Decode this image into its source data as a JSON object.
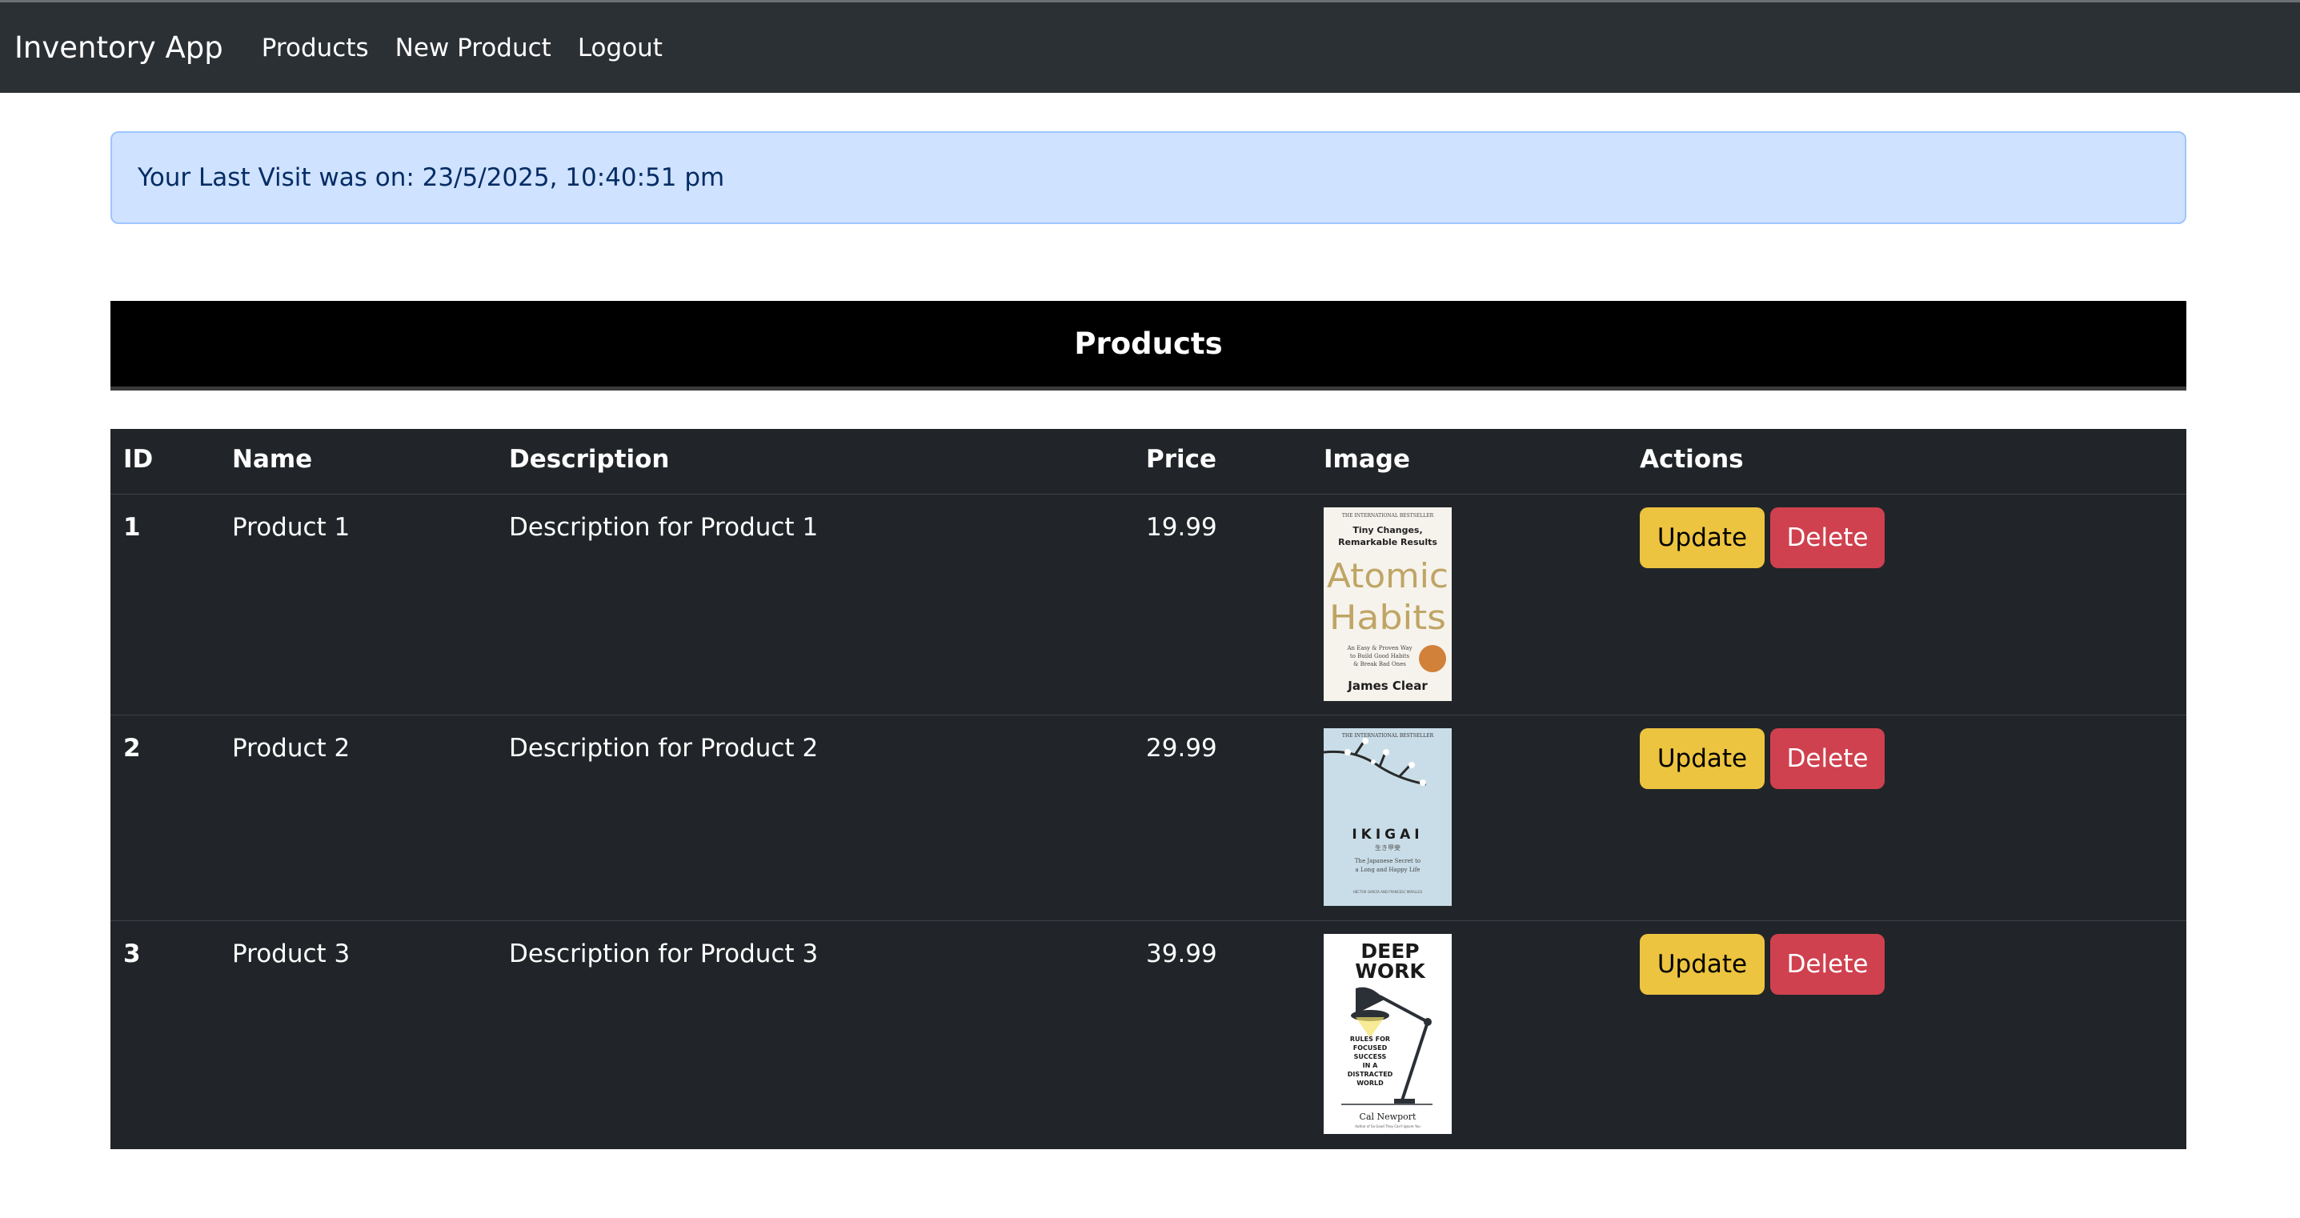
{
  "nav": {
    "brand": "Inventory App",
    "links": [
      "Products",
      "New Product",
      "Logout"
    ]
  },
  "alert": {
    "text": "Your Last Visit was on: 23/5/2025, 10:40:51 pm"
  },
  "products_header": "Products",
  "table": {
    "columns": [
      "ID",
      "Name",
      "Description",
      "Price",
      "Image",
      "Actions"
    ],
    "rows": [
      {
        "id": "1",
        "name": "Product 1",
        "description": "Description for Product 1",
        "price": "19.99",
        "cover": {
          "top": "THE INTERNATIONAL BESTSELLER",
          "tagline1": "Tiny Changes,",
          "tagline2": "Remarkable Results",
          "title1": "Atomic",
          "title2": "Habits",
          "sub1": "An Easy & Proven Way",
          "sub2": "to Build Good Habits",
          "sub3": "& Break Bad Ones",
          "author": "James Clear"
        }
      },
      {
        "id": "2",
        "name": "Product 2",
        "description": "Description for Product 2",
        "price": "29.99",
        "cover": {
          "top": "THE INTERNATIONAL BESTSELLER",
          "title": "IKIGAI",
          "jp": "生き甲斐",
          "sub1": "The Japanese Secret to",
          "sub2": "a Long and Happy Life",
          "authors": "HÉCTOR GARCÍA AND FRANCESC MIRALLES"
        }
      },
      {
        "id": "3",
        "name": "Product 3",
        "description": "Description for Product 3",
        "price": "39.99",
        "cover": {
          "title1": "DEEP",
          "title2": "WORK",
          "rules1": "RULES FOR",
          "rules2": "FOCUSED",
          "rules3": "SUCCESS",
          "rules4": "IN A",
          "rules5": "DISTRACTED",
          "rules6": "WORLD",
          "author": "Cal Newport",
          "note": "Author of So Good They Can't Ignore You"
        }
      }
    ],
    "update_label": "Update",
    "delete_label": "Delete"
  },
  "colors": {
    "navbar": "#2b3035",
    "alert_bg": "#cfe2ff",
    "table_bg": "#212529",
    "update": "#ecc440",
    "delete": "#cf414f"
  }
}
